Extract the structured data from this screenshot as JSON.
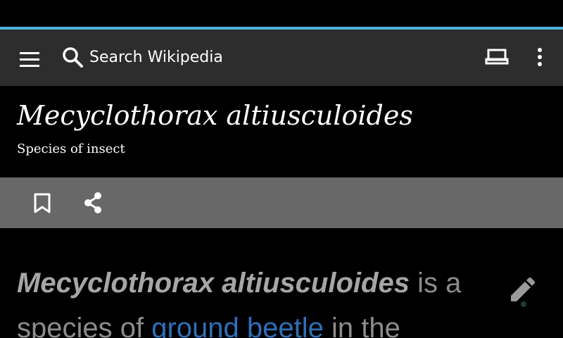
{
  "toolbar": {
    "search_label": "Search Wikipedia",
    "icons": {
      "menu": "hamburger-menu-icon",
      "search": "magnifier-icon",
      "reading_lists": "reading-list-icon",
      "overflow": "vertical-dots-icon"
    }
  },
  "page_load_progress": 1.0,
  "article": {
    "title": "Mecyclothorax altiusculoides",
    "description": "Species of insect",
    "actions": {
      "bookmark": "bookmark-icon",
      "share": "share-icon",
      "edit": "pencil-icon"
    },
    "lead": {
      "bold_title": "Mecyclothorax altiusculoides",
      "text1": " is a species of ",
      "link": "ground beetle",
      "text2": " in the"
    }
  },
  "colors": {
    "toolbar_bg": "#2d2d2d",
    "action_bar_bg": "#686868",
    "progress": "#4fb3d9",
    "link": "#2f6fb8",
    "body_text": "#8c8c8c"
  }
}
